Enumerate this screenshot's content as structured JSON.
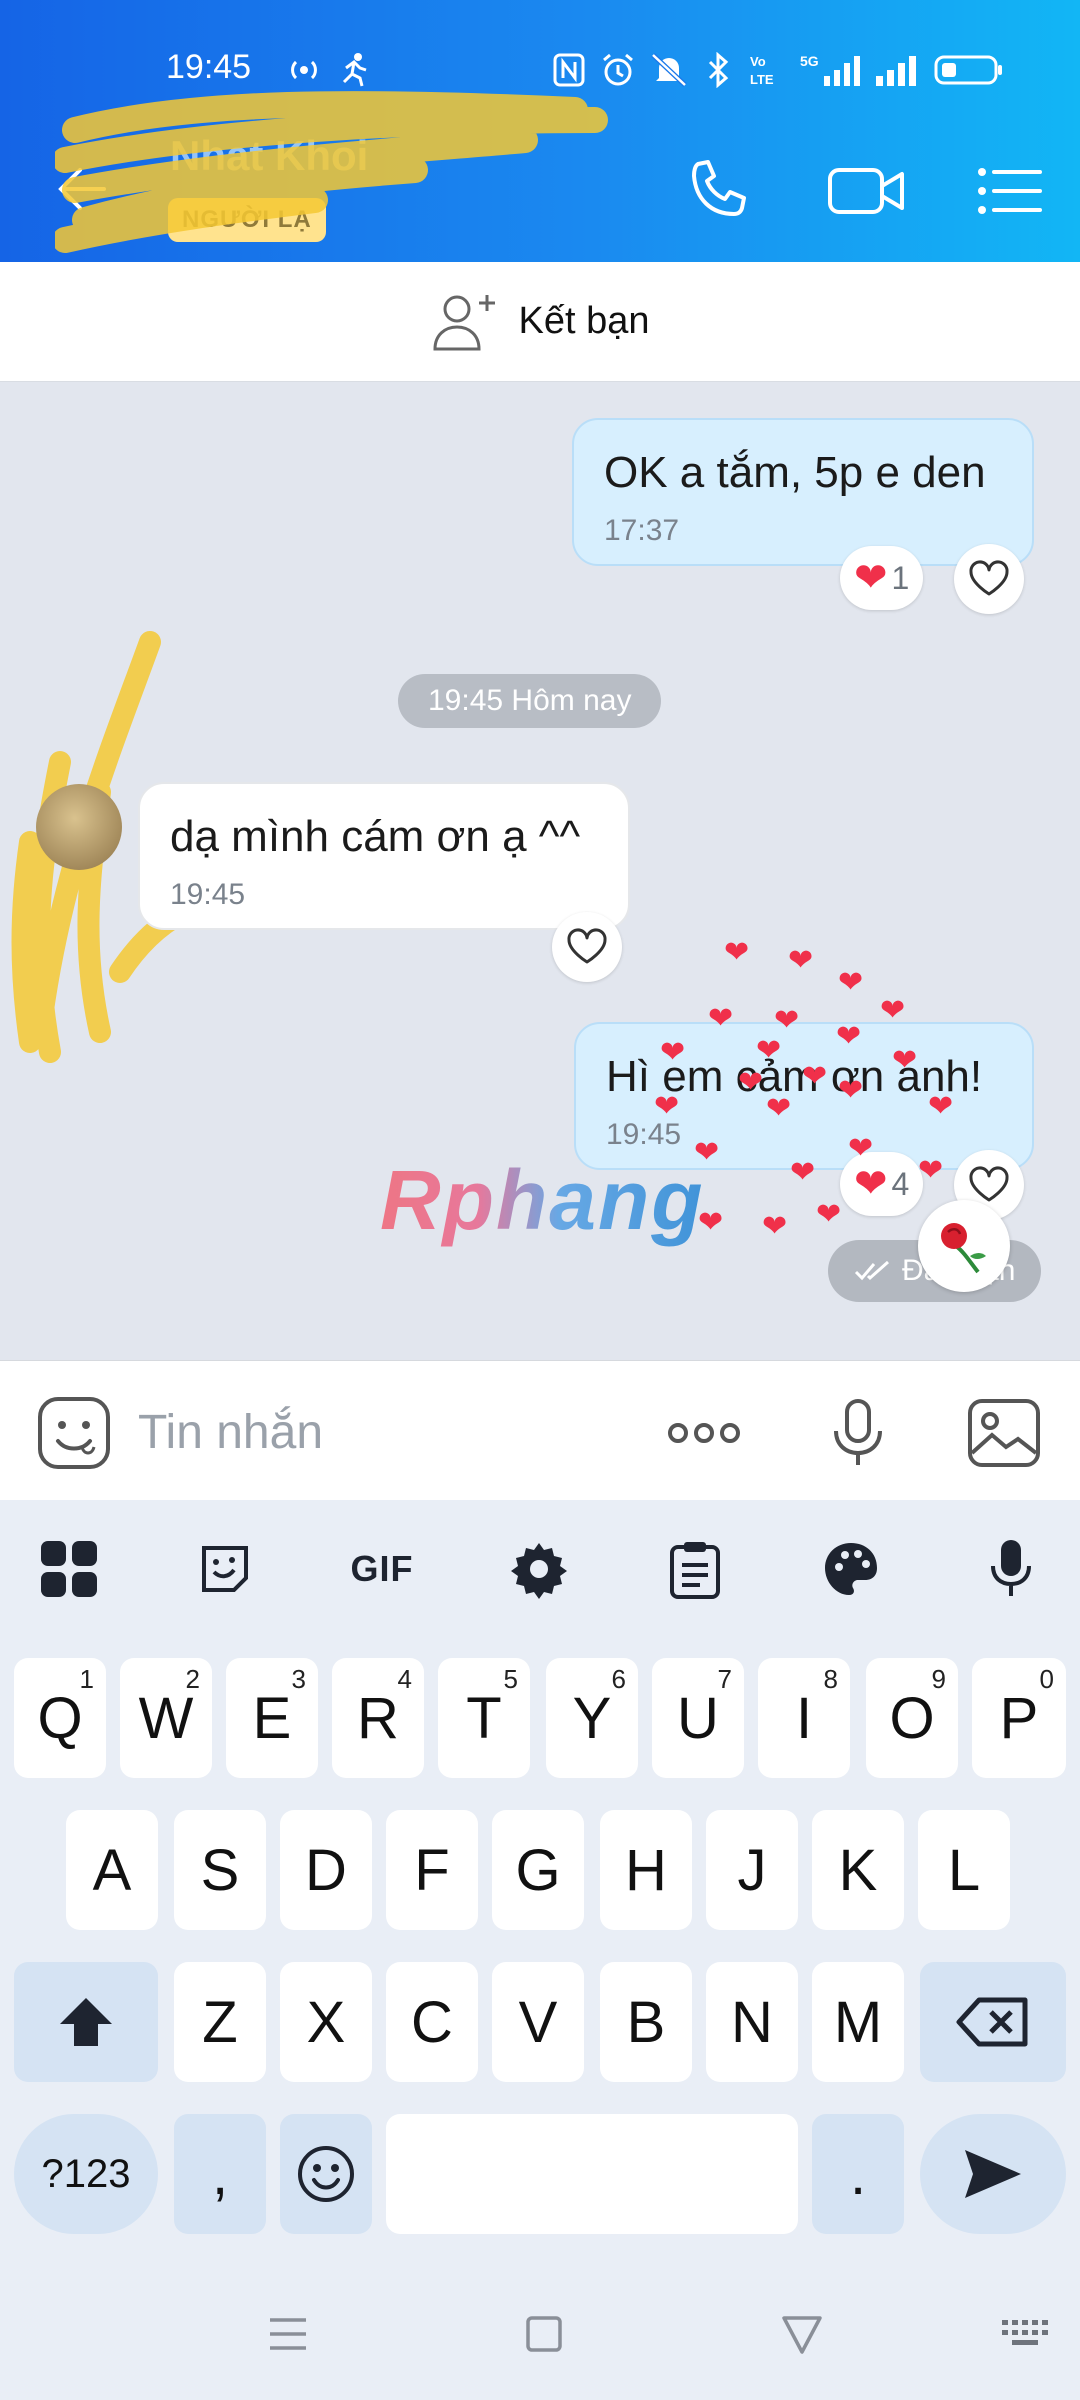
{
  "status_bar": {
    "time": "19:45",
    "network": "5G"
  },
  "header": {
    "contact_name": "Nhat Khoi",
    "badge": "NGƯỜI LẠ"
  },
  "add_friend": {
    "label": "Kết bạn"
  },
  "messages": [
    {
      "direction": "out",
      "text": "OK a tắm, 5p e den",
      "time": "17:37",
      "reaction_count": "1"
    },
    {
      "direction": "in",
      "text": "dạ mình cám ơn ạ ^^",
      "time": "19:45"
    },
    {
      "direction": "out",
      "text": "Hì em cảm ơn anh!",
      "time": "19:45",
      "reaction_count": "4"
    }
  ],
  "date_separator": "19:45 Hôm nay",
  "sent_status": "Đã nhận",
  "watermark": "Rphang",
  "input": {
    "placeholder": "Tin nhắn"
  },
  "keyboard": {
    "row1": [
      "Q",
      "W",
      "E",
      "R",
      "T",
      "Y",
      "U",
      "I",
      "O",
      "P"
    ],
    "row1_hints": [
      "1",
      "2",
      "3",
      "4",
      "5",
      "6",
      "7",
      "8",
      "9",
      "0"
    ],
    "row2": [
      "A",
      "S",
      "D",
      "F",
      "G",
      "H",
      "J",
      "K",
      "L"
    ],
    "row3": [
      "Z",
      "X",
      "C",
      "V",
      "B",
      "N",
      "M"
    ],
    "symbols_key": "?123",
    "comma_key": ",",
    "period_key": ".",
    "gif_label": "GIF"
  },
  "colors": {
    "header_start": "#1564e6",
    "header_end": "#12b6f5",
    "outgoing_bubble": "#d7effe",
    "heart": "#f0304a"
  }
}
